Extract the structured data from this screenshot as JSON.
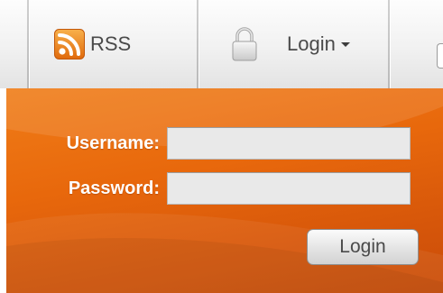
{
  "toolbar": {
    "rss": {
      "label": "RSS",
      "icon": "rss-feed-icon"
    },
    "login": {
      "label": "Login",
      "icon": "padlock-icon"
    }
  },
  "login_form": {
    "username_label": "Username:",
    "username_value": "",
    "password_label": "Password:",
    "password_value": "",
    "submit_label": "Login"
  },
  "colors": {
    "panel_orange": "#e8680c",
    "rss_orange": "#f39a2e",
    "toolbar_gray": "#f1f1f1"
  }
}
